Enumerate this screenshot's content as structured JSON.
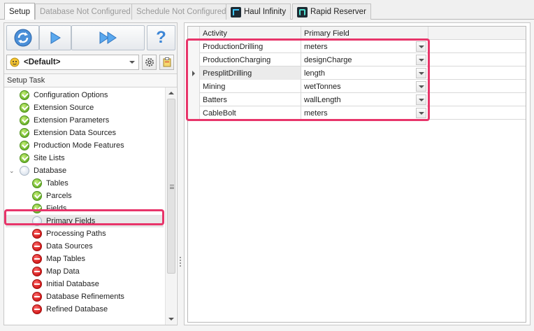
{
  "tabs": [
    {
      "label": "Setup"
    },
    {
      "label": "Database Not Configured"
    },
    {
      "label": "Schedule Not Configured"
    },
    {
      "label": "Haul Infinity"
    },
    {
      "label": "Rapid Reserver"
    }
  ],
  "toolbar": {
    "profile_value": "<Default>",
    "help_label": "?"
  },
  "tree": {
    "header": "Setup Task",
    "items": [
      {
        "label": "Configuration Options",
        "status": "complete"
      },
      {
        "label": "Extension Source",
        "status": "complete"
      },
      {
        "label": "Extension Parameters",
        "status": "complete"
      },
      {
        "label": "Extension Data Sources",
        "status": "complete"
      },
      {
        "label": "Production Mode Features",
        "status": "complete"
      },
      {
        "label": "Site Lists",
        "status": "complete"
      },
      {
        "label": "Database",
        "status": "pending"
      },
      {
        "label": "Tables",
        "status": "complete"
      },
      {
        "label": "Parcels",
        "status": "complete"
      },
      {
        "label": "Fields",
        "status": "complete"
      },
      {
        "label": "Primary Fields",
        "status": "pending"
      },
      {
        "label": "Processing Paths",
        "status": "error"
      },
      {
        "label": "Data Sources",
        "status": "error"
      },
      {
        "label": "Map Tables",
        "status": "error"
      },
      {
        "label": "Map Data",
        "status": "error"
      },
      {
        "label": "Initial Database",
        "status": "error"
      },
      {
        "label": "Database Refinements",
        "status": "error"
      },
      {
        "label": "Refined Database",
        "status": "error"
      }
    ]
  },
  "grid": {
    "columns": [
      "Activity",
      "Primary Field"
    ],
    "rows": [
      {
        "activity": "ProductionDrilling",
        "field": "meters"
      },
      {
        "activity": "ProductionCharging",
        "field": "designCharge"
      },
      {
        "activity": "PresplitDrilling",
        "field": "length"
      },
      {
        "activity": "Mining",
        "field": "wetTonnes"
      },
      {
        "activity": "Batters",
        "field": "wallLength"
      },
      {
        "activity": "CableBolt",
        "field": "meters"
      }
    ]
  },
  "colors": {
    "highlight": "#e8356a",
    "complete": "#6db52c",
    "error": "#d21a1a"
  }
}
